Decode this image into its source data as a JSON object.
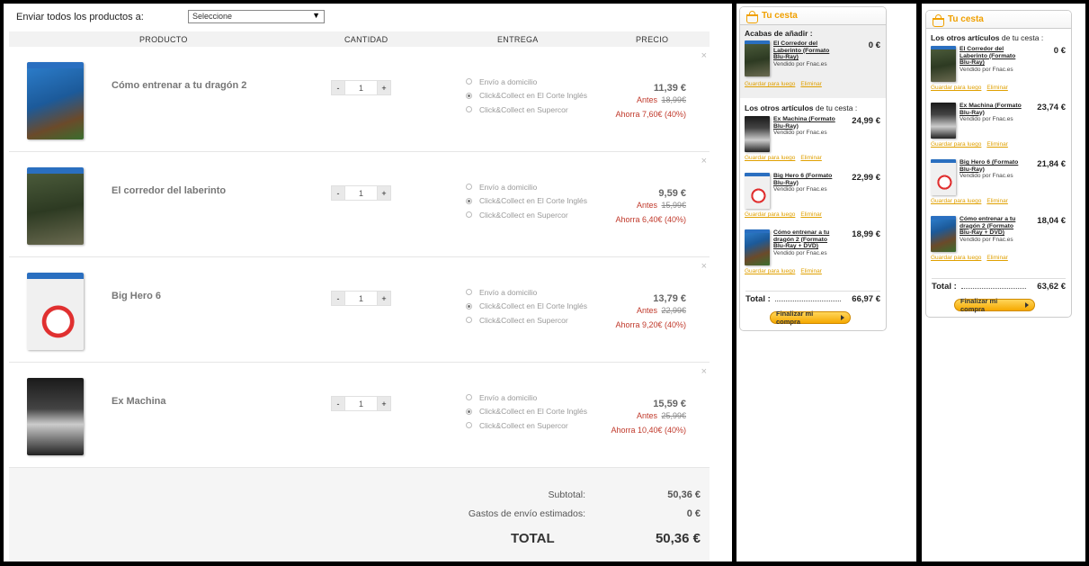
{
  "cart": {
    "ship_label": "Enviar todos los productos a:",
    "ship_select_value": "Seleccione",
    "columns": {
      "product": "PRODUCTO",
      "quantity": "CANTIDAD",
      "delivery": "ENTREGA",
      "price": "PRECIO"
    },
    "items": [
      {
        "name": "Cómo entrenar a tu dragón 2",
        "qty": "1",
        "price": "11,39 €",
        "before_label": "Antes",
        "before": "18,99€",
        "save": "Ahorra 7,60€ (40%)"
      },
      {
        "name": "El corredor del laberinto",
        "qty": "1",
        "price": "9,59 €",
        "before_label": "Antes",
        "before": "15,99€",
        "save": "Ahorra 6,40€ (40%)"
      },
      {
        "name": "Big Hero 6",
        "qty": "1",
        "price": "13,79 €",
        "before_label": "Antes",
        "before": "22,99€",
        "save": "Ahorra 9,20€ (40%)"
      },
      {
        "name": "Ex Machina",
        "qty": "1",
        "price": "15,59 €",
        "before_label": "Antes",
        "before": "25,99€",
        "save": "Ahorra 10,40€ (40%)"
      }
    ],
    "delivery_options": [
      "Envío a domicilio",
      "Click&Collect en El Corte Inglés",
      "Click&Collect en Supercor"
    ],
    "selected_delivery": 1,
    "minus": "-",
    "plus": "+",
    "remove": "×",
    "totals": {
      "subtotal_label": "Subtotal:",
      "subtotal": "50,36 €",
      "shipping_label": "Gastos de envío estimados:",
      "shipping": "0 €",
      "total_label": "TOTAL",
      "total": "50,36 €"
    }
  },
  "mini1": {
    "title": "Tu cesta",
    "just_added_title": "Acabas de añadir :",
    "just_added": {
      "title": "El Corredor del Laberinto (Formato Blu-Ray)",
      "seller": "Vendido por Fnac.es",
      "price": "0 €"
    },
    "others_title_bold": "Los otros artículos",
    "others_title_rest": "de tu cesta :",
    "items": [
      {
        "title": "Ex Machina (Formato Blu-Ray)",
        "seller": "Vendido por Fnac.es",
        "price": "24,99 €"
      },
      {
        "title": "Big Hero 6 (Formato Blu-Ray)",
        "seller": "Vendido por Fnac.es",
        "price": "22,99 €"
      },
      {
        "title": "Cómo entrenar a tu dragón 2 (Formato Blu-Ray + DVD)",
        "seller": "Vendido por Fnac.es",
        "price": "18,99 €"
      }
    ],
    "save_later": "Guardar para luego",
    "delete": "Eliminar",
    "total_label": "Total :",
    "total": "66,97 €",
    "checkout": "Finalizar mi compra"
  },
  "mini2": {
    "title": "Tu cesta",
    "others_title_bold": "Los otros artículos",
    "others_title_rest": "de tu cesta :",
    "items": [
      {
        "title": "El Corredor del Laberinto (Formato Blu-Ray)",
        "seller": "Vendido por Fnac.es",
        "price": "0 €"
      },
      {
        "title": "Ex Machina (Formato Blu-Ray)",
        "seller": "Vendido por Fnac.es",
        "price": "23,74 €"
      },
      {
        "title": "Big Hero 6 (Formato Blu-Ray)",
        "seller": "Vendido por Fnac.es",
        "price": "21,84 €"
      },
      {
        "title": "Cómo entrenar a tu dragón 2 (Formato Blu-Ray + DVD)",
        "seller": "Vendido por Fnac.es",
        "price": "18,04 €"
      }
    ],
    "save_later": "Guardar para luego",
    "delete": "Eliminar",
    "total_label": "Total :",
    "total": "63,62 €",
    "checkout": "Finalizar mi compra"
  },
  "colors": {
    "accent": "#f0a000",
    "sale": "#c0392b"
  },
  "icons": {
    "basket": "basket-icon",
    "remove": "close-icon",
    "dropdown": "chevron-down-icon"
  }
}
